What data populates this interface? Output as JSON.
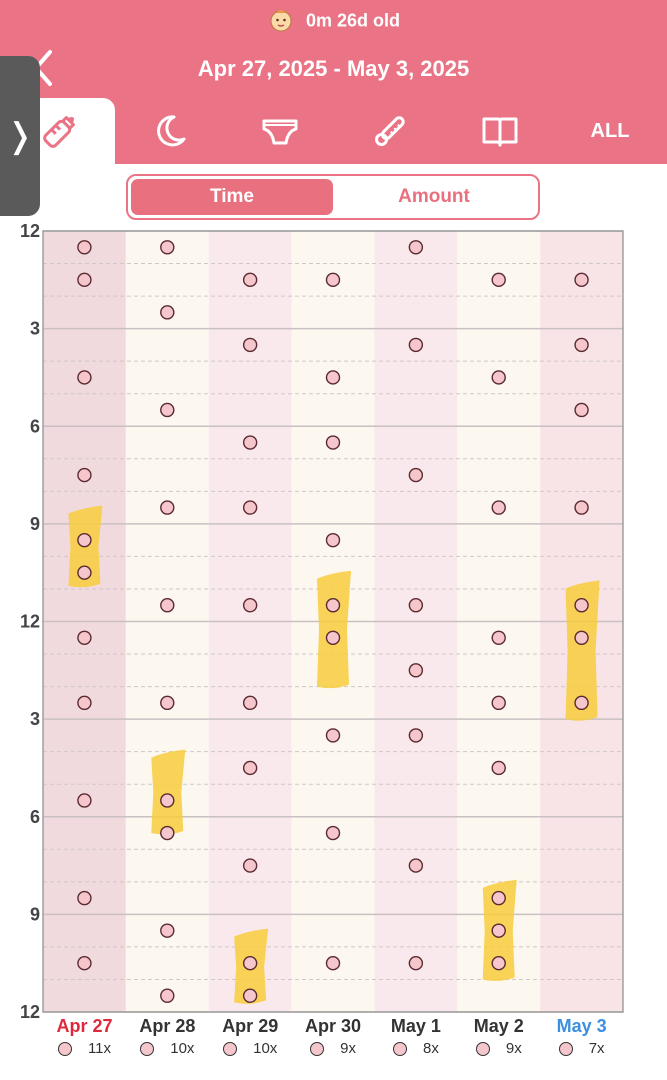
{
  "header": {
    "age": "0m 26d old",
    "date_range": "Apr 27, 2025 - May 3, 2025",
    "tabs": [
      {
        "icon": "bottle-icon",
        "active": true
      },
      {
        "icon": "moon-icon",
        "active": false
      },
      {
        "icon": "diaper-icon",
        "active": false
      },
      {
        "icon": "thermometer-icon",
        "active": false
      },
      {
        "icon": "book-icon",
        "active": false
      },
      {
        "label": "ALL",
        "active": false
      }
    ]
  },
  "segment": {
    "time": "Time",
    "amount": "Amount"
  },
  "colors": {
    "header": "#ea7385",
    "accent": "#e8707f",
    "sleep": "#f8cd3c",
    "today": "#3a8fe0",
    "weekend": "#e0283c"
  },
  "chart_data": {
    "type": "scatter",
    "y_ticks": [
      "12",
      "3",
      "6",
      "9",
      "12",
      "3",
      "6",
      "9",
      "12"
    ],
    "y_range_hours": [
      0,
      24
    ],
    "days": [
      {
        "label": "Apr 27",
        "count": "11x",
        "feeds": [
          0.5,
          1.5,
          4.5,
          7.5,
          9.5,
          10.5,
          12.5,
          14.5,
          17.5,
          20.5,
          22.5
        ],
        "sleep": [
          [
            8.5,
            10.9
          ]
        ]
      },
      {
        "label": "Apr 28",
        "count": "10x",
        "feeds": [
          0.5,
          2.5,
          5.5,
          8.5,
          11.5,
          14.5,
          17.5,
          18.5,
          21.5,
          23.5
        ],
        "sleep": [
          [
            16.0,
            18.5
          ]
        ]
      },
      {
        "label": "Apr 29",
        "count": "10x",
        "feeds": [
          1.5,
          3.5,
          6.5,
          8.5,
          11.5,
          14.5,
          16.5,
          19.5,
          22.5,
          23.5
        ],
        "sleep": [
          [
            21.5,
            23.7
          ]
        ]
      },
      {
        "label": "Apr 30",
        "count": "9x",
        "feeds": [
          1.5,
          4.5,
          6.5,
          9.5,
          11.5,
          12.5,
          15.5,
          18.5,
          22.5
        ],
        "sleep": [
          [
            10.5,
            14.0
          ]
        ]
      },
      {
        "label": "May 1",
        "count": "8x",
        "feeds": [
          0.5,
          3.5,
          7.5,
          11.5,
          13.5,
          15.5,
          19.5,
          22.5
        ],
        "sleep": []
      },
      {
        "label": "May 2",
        "count": "9x",
        "feeds": [
          1.5,
          4.5,
          8.5,
          12.5,
          14.5,
          16.5,
          20.5,
          21.5,
          22.5
        ],
        "sleep": [
          [
            20.0,
            23.0
          ]
        ]
      },
      {
        "label": "May 3",
        "count": "7x",
        "feeds": [
          1.5,
          3.5,
          5.5,
          8.5,
          11.5,
          12.5,
          14.5
        ],
        "sleep": [
          [
            10.8,
            15.0
          ]
        ]
      }
    ]
  }
}
